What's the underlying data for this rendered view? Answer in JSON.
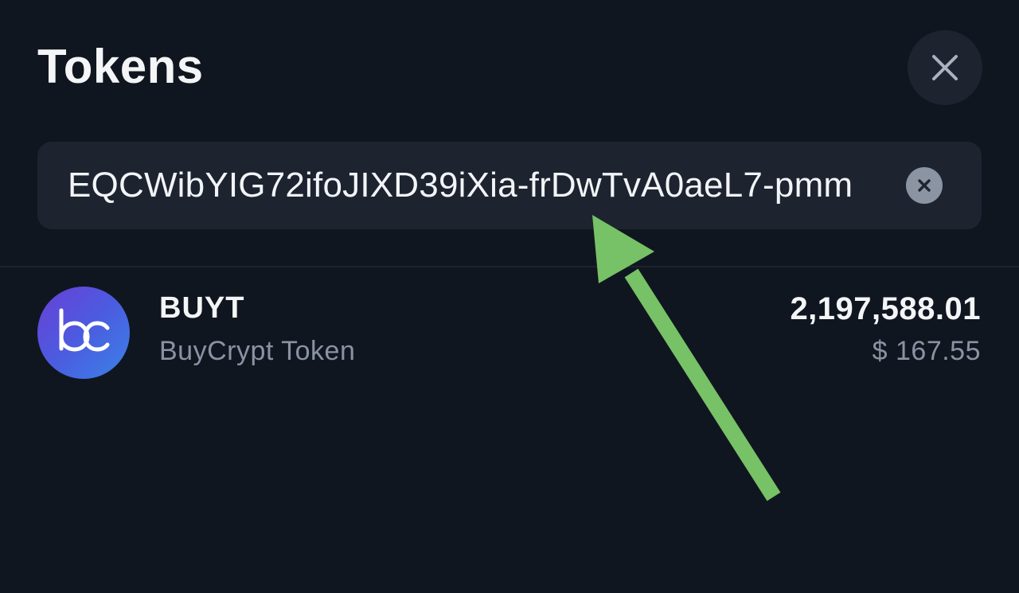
{
  "header": {
    "title": "Tokens"
  },
  "search": {
    "value": "EQCWibYIG72ifoJIXD39iXia-frDwTvA0aeL7-pmm"
  },
  "tokens": [
    {
      "symbol": "BUYT",
      "name": "BuyCrypt Token",
      "amount": "2,197,588.01",
      "fiat_value": "$ 167.55",
      "logo_text": "bc"
    }
  ],
  "icons": {
    "close": "close-icon",
    "clear": "clear-icon",
    "logo": "buycrypt-logo-icon",
    "annotation": "arrow-icon"
  },
  "colors": {
    "background": "#10161f",
    "surface": "#1d2430",
    "text_primary": "#f4f5f7",
    "text_secondary": "#8a93a3",
    "annotation_arrow": "#77c167",
    "logo_gradient_start": "#6a3fd6",
    "logo_gradient_end": "#3b82e6"
  }
}
